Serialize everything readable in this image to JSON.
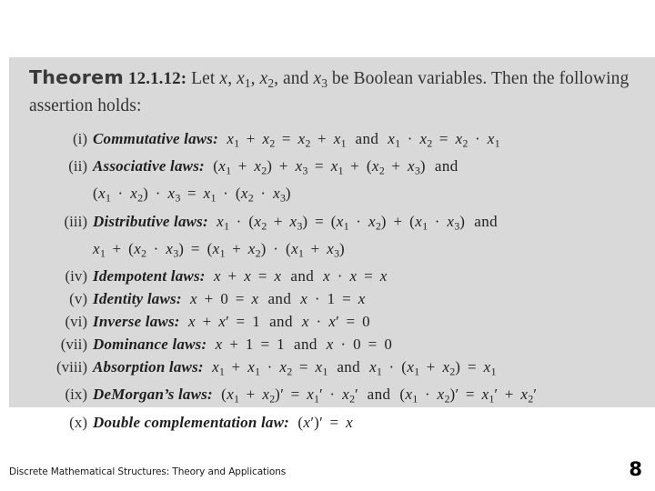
{
  "slide": {
    "background_color": "#ffffff",
    "content_block_color": "#d9d9d9"
  },
  "theorem": {
    "label": "Theorem",
    "number": "12.1.12:",
    "statement": "Let x, x₁, x₂, and x₃ be Boolean variables. Then the following assertion holds:"
  },
  "laws": [
    {
      "numeral": "(i)",
      "name": "Commutative laws:",
      "formulas": [
        "x₁ + x₂ = x₂ + x₁",
        "x₁ · x₂ = x₂ · x₁"
      ],
      "conjunction": "and"
    },
    {
      "numeral": "(ii)",
      "name": "Associative laws:",
      "formulas": [
        "(x₁ + x₂) + x₃ = x₁ + (x₂ + x₃)",
        "(x₁ · x₂) · x₃ = x₁ · (x₂ · x₃)"
      ],
      "conjunction": "and"
    },
    {
      "numeral": "(iii)",
      "name": "Distributive laws:",
      "formulas": [
        "x₁ · (x₂ + x₃) = (x₁ · x₂) + (x₁ · x₃)",
        "x₁ + (x₂ · x₃) = (x₁ + x₂) · (x₁ + x₃)"
      ],
      "conjunction": "and"
    },
    {
      "numeral": "(iv)",
      "name": "Idempotent laws:",
      "formulas": [
        "x + x = x",
        "x · x = x"
      ],
      "conjunction": "and"
    },
    {
      "numeral": "(v)",
      "name": "Identity laws:",
      "formulas": [
        "x + 0 = x",
        "x · 1 = x"
      ],
      "conjunction": "and"
    },
    {
      "numeral": "(vi)",
      "name": "Inverse laws:",
      "formulas": [
        "x + x′ = 1",
        "x · x′ = 0"
      ],
      "conjunction": "and"
    },
    {
      "numeral": "(vii)",
      "name": "Dominance laws:",
      "formulas": [
        "x + 1 = 1",
        "x · 0 = 0"
      ],
      "conjunction": "and"
    },
    {
      "numeral": "(viii)",
      "name": "Absorption laws:",
      "formulas": [
        "x₁ + x₁ · x₂ = x₁",
        "x₁ · (x₁ + x₂) = x₁"
      ],
      "conjunction": "and"
    },
    {
      "numeral": "(ix)",
      "name": "DeMorgan’s laws:",
      "formulas": [
        "(x₁ + x₂)′ = x₁′ · x₂′",
        "(x₁ · x₂)′ = x₁′ + x₂′"
      ],
      "conjunction": "and"
    },
    {
      "numeral": "(x)",
      "name": "Double complementation law:",
      "formulas": [
        "(x′)′ = x"
      ],
      "conjunction": ""
    }
  ],
  "footer": {
    "title": "Discrete Mathematical Structures: Theory and Applications",
    "page_number": "8"
  }
}
